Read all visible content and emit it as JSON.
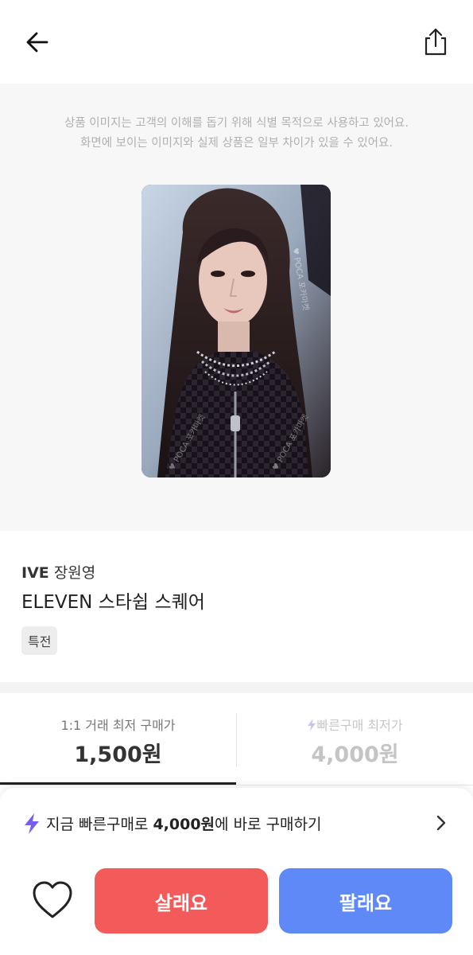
{
  "header": {
    "back_icon": "arrow-left-icon",
    "share_icon": "share-icon"
  },
  "image_notice": {
    "line1": "상품 이미지는 고객의 이해를 돕기 위해 식별 목적으로 사용하고 있어요.",
    "line2": "화면에 보이는 이미지와 실제 상품은 일부 차이가 있을 수 있어요."
  },
  "product": {
    "group": "IVE",
    "member": "장원영",
    "name": "ELEVEN 스타쉽 스퀘어",
    "tag": "특전",
    "watermark": "POCA 포카마켓"
  },
  "prices": {
    "left_label": "1:1 거래 최저 구매가",
    "left_value": "1,500원",
    "right_label": "빠른구매 최저가",
    "right_value": "4,000원"
  },
  "quick_buy": {
    "prefix": "지금 빠른구매로",
    "amount": "4,000원",
    "suffix": "에 바로 구매하기"
  },
  "actions": {
    "buy_label": "살래요",
    "sell_label": "팔래요",
    "heart_icon": "heart-icon"
  },
  "colors": {
    "buy": "#f35a5a",
    "sell": "#5e89f7",
    "bolt": "#7a5cf0"
  }
}
